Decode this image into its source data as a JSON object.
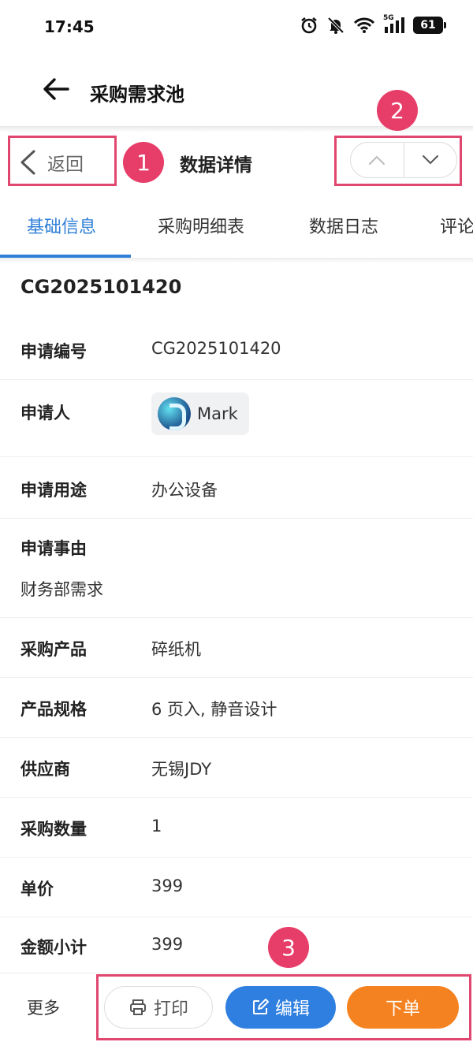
{
  "status_bar": {
    "time": "17:45",
    "network": "5G",
    "battery": "61"
  },
  "header": {
    "title": "采购需求池"
  },
  "detail_bar": {
    "back_label": "返回",
    "title": "数据详情"
  },
  "tabs": [
    {
      "label": "基础信息",
      "active": true
    },
    {
      "label": "采购明细表",
      "active": false
    },
    {
      "label": "数据日志",
      "active": false
    },
    {
      "label": "评论",
      "active": false
    }
  ],
  "record": {
    "title": "CG2025101420",
    "fields": {
      "apply_no": {
        "label": "申请编号",
        "value": "CG2025101420"
      },
      "applicant": {
        "label": "申请人",
        "value": "Mark"
      },
      "purpose": {
        "label": "申请用途",
        "value": "办公设备"
      },
      "reason": {
        "label": "申请事由",
        "value": "财务部需求"
      },
      "product": {
        "label": "采购产品",
        "value": "碎纸机"
      },
      "spec": {
        "label": "产品规格",
        "value": "6 页入, 静音设计"
      },
      "supplier": {
        "label": "供应商",
        "value": "无锡JDY"
      },
      "quantity": {
        "label": "采购数量",
        "value": "1"
      },
      "unit_price": {
        "label": "单价",
        "value": "399"
      },
      "subtotal": {
        "label": "金额小计",
        "value": "399"
      }
    }
  },
  "bottom_bar": {
    "more": "更多",
    "print": "打印",
    "edit": "编辑",
    "order": "下单"
  },
  "annotations": {
    "a1": "1",
    "a2": "2",
    "a3": "3"
  },
  "colors": {
    "accent": "#2f7fd6",
    "edit": "#2f7fe0",
    "order": "#f58220",
    "annotation": "#e73d69"
  }
}
